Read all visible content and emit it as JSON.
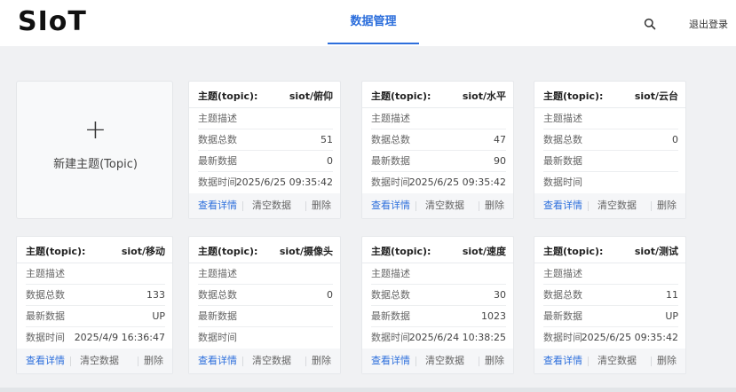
{
  "header": {
    "logo": "SIoT",
    "nav_tab": "数据管理",
    "logout": "退出登录",
    "search_icon": "search-icon"
  },
  "new_topic": {
    "plus": "+",
    "label": "新建主题(Topic)"
  },
  "labels": {
    "topic_key": "主题(topic):",
    "desc": "主题描述",
    "count": "数据总数",
    "latest": "最新数据",
    "time": "数据时间",
    "detail": "查看详情",
    "clear": "清空数据",
    "delete": "删除"
  },
  "colors": {
    "accent": "#2d6fdc"
  },
  "cards": [
    {
      "topic": "siot/俯仰",
      "desc": "",
      "count": "51",
      "latest": "0",
      "time": "2025/6/25 09:35:42"
    },
    {
      "topic": "siot/水平",
      "desc": "",
      "count": "47",
      "latest": "90",
      "time": "2025/6/25 09:35:42"
    },
    {
      "topic": "siot/云台",
      "desc": "",
      "count": "0",
      "latest": "",
      "time": ""
    },
    {
      "topic": "siot/移动",
      "desc": "",
      "count": "133",
      "latest": "UP",
      "time": "2025/4/9 16:36:47"
    },
    {
      "topic": "siot/摄像头",
      "desc": "",
      "count": "0",
      "latest": "",
      "time": ""
    },
    {
      "topic": "siot/速度",
      "desc": "",
      "count": "30",
      "latest": "1023",
      "time": "2025/6/24 10:38:25"
    },
    {
      "topic": "siot/测试",
      "desc": "",
      "count": "11",
      "latest": "UP",
      "time": "2025/6/25 09:35:42"
    }
  ]
}
